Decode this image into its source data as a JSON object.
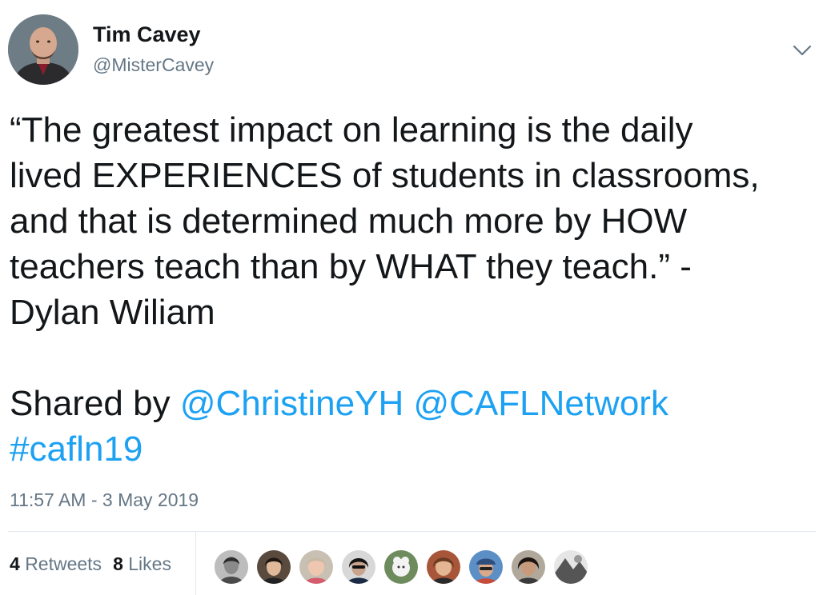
{
  "author": {
    "name": "Tim Cavey",
    "handle": "@MisterCavey"
  },
  "tweet": {
    "quote_lines": [
      "“The greatest impact on learning is the daily",
      "lived EXPERIENCES of students in classrooms,",
      "and that is determined much more by HOW",
      "teachers teach than by WHAT they teach.” -",
      "Dylan Wiliam"
    ],
    "shared_by_label": "Shared by ",
    "mention_1": "@ChristineYH",
    "mention_2": "@CAFLNetwork",
    "hashtag": "#cafln19"
  },
  "timestamp": "11:57 AM - 3 May 2019",
  "stats": {
    "retweet_count": "4",
    "retweet_label": "Retweets",
    "like_count": "8",
    "like_label": "Likes"
  },
  "icons": {
    "menu": "chevron-down-icon"
  },
  "colors": {
    "link": "#1da1f2",
    "secondary_text": "#657786",
    "primary_text": "#14171a",
    "divider": "#e1e8ed"
  }
}
